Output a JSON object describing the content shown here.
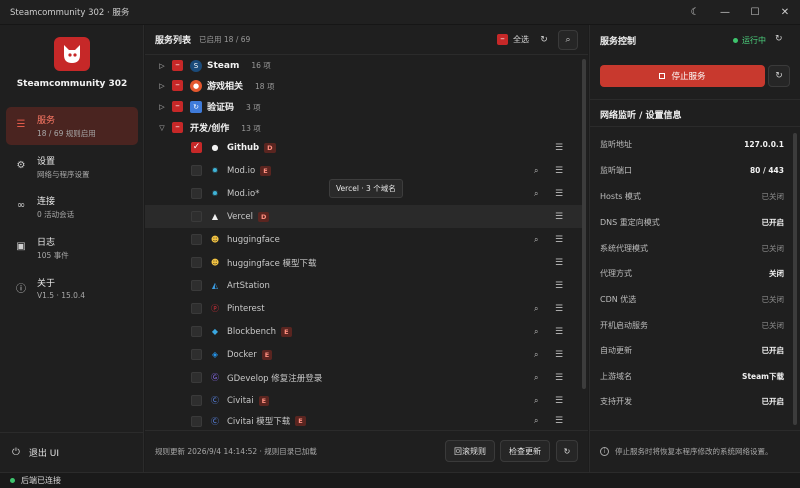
{
  "window": {
    "title": "Steamcommunity 302 · 服务"
  },
  "app": {
    "name": "Steamcommunity 302"
  },
  "nav": [
    {
      "label": "服务",
      "sub": "18 / 69 规则启用"
    },
    {
      "label": "设置",
      "sub": "网络与程序设置"
    },
    {
      "label": "连接",
      "sub": "0 活动会话"
    },
    {
      "label": "日志",
      "sub": "105 事件"
    },
    {
      "label": "关于",
      "sub": "V1.5 · 15.0.4"
    }
  ],
  "exit_label": "退出 UI",
  "status_text": "后端已连接",
  "services": {
    "title": "服务列表",
    "count": "已启用 18 / 69",
    "select_all": "全选",
    "groups": [
      {
        "name": "Steam",
        "count": "16 项",
        "expand": "▷"
      },
      {
        "name": "游戏相关",
        "count": "18 项",
        "expand": "▷"
      },
      {
        "name": "验证码",
        "count": "3 项",
        "expand": "▷"
      },
      {
        "name": "开发/创作",
        "count": "13 项",
        "expand": "▽"
      }
    ],
    "items": [
      {
        "name": "Github",
        "tag": "D"
      },
      {
        "name": "Mod.io",
        "tag": "E"
      },
      {
        "name": "Mod.io*",
        "tag": ""
      },
      {
        "name": "Vercel",
        "tag": "D"
      },
      {
        "name": "huggingface",
        "tag": ""
      },
      {
        "name": "huggingface 模型下载",
        "tag": ""
      },
      {
        "name": "ArtStation",
        "tag": ""
      },
      {
        "name": "Pinterest",
        "tag": ""
      },
      {
        "name": "Blockbench",
        "tag": "E"
      },
      {
        "name": "Docker",
        "tag": "E"
      },
      {
        "name": "GDevelop 修复注册登录",
        "tag": ""
      },
      {
        "name": "Civitai",
        "tag": "E"
      },
      {
        "name": "Civitai 模型下载",
        "tag": "E"
      }
    ],
    "tooltip": "Vercel · 3 个域名",
    "footer_text": "规则更新 2026/9/4 14:14:52 · 规则目录已加载",
    "rollback_label": "回滚规则",
    "check_update_label": "检查更新"
  },
  "control": {
    "title": "服务控制",
    "running": "运行中",
    "stop_label": "停止服务",
    "section_title": "网络监听 / 设置信息",
    "rows": [
      {
        "k": "监听地址",
        "v": "127.0.0.1",
        "dim": false
      },
      {
        "k": "监听端口",
        "v": "80 / 443",
        "dim": false
      },
      {
        "k": "Hosts 模式",
        "v": "已关闭",
        "dim": true
      },
      {
        "k": "DNS 重定向模式",
        "v": "已开启",
        "dim": false
      },
      {
        "k": "系统代理模式",
        "v": "已关闭",
        "dim": true
      },
      {
        "k": "代理方式",
        "v": "关闭",
        "dim": false
      },
      {
        "k": "CDN 优选",
        "v": "已关闭",
        "dim": true
      },
      {
        "k": "开机启动服务",
        "v": "已关闭",
        "dim": true
      },
      {
        "k": "自动更新",
        "v": "已开启",
        "dim": false
      },
      {
        "k": "上游域名",
        "v": "Steam下载",
        "dim": false
      },
      {
        "k": "支持开发",
        "v": "已开启",
        "dim": false
      }
    ],
    "footer_text": "停止服务时将恢复本程序修改的系统网络设置。"
  },
  "colors": {
    "accent": "#c62828",
    "active_nav_bg": "#4a2420",
    "running": "#4cd07d"
  }
}
